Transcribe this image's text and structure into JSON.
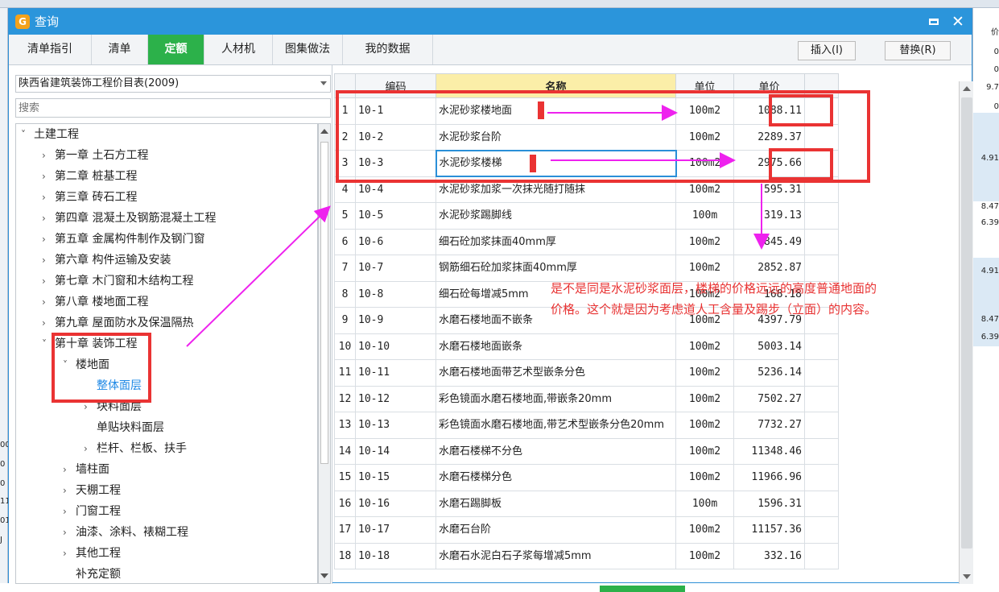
{
  "window": {
    "title": "查询"
  },
  "tabs": [
    {
      "label": "清单指引",
      "active": false
    },
    {
      "label": "清单",
      "active": false
    },
    {
      "label": "定额",
      "active": true
    },
    {
      "label": "人材机",
      "active": false
    },
    {
      "label": "图集做法",
      "active": false
    },
    {
      "label": "我的数据",
      "active": false
    }
  ],
  "actions": {
    "insert": "插入(I)",
    "replace": "替换(R)"
  },
  "left": {
    "library": "陕西省建筑装饰工程价目表(2009)",
    "search_placeholder": "搜索",
    "tree": [
      {
        "label": "土建工程",
        "chev": "˅"
      },
      {
        "label": "第一章 土石方工程",
        "chev": "›"
      },
      {
        "label": "第二章 桩基工程",
        "chev": "›"
      },
      {
        "label": "第三章 砖石工程",
        "chev": "›"
      },
      {
        "label": "第四章 混凝土及钢筋混凝土工程",
        "chev": "›"
      },
      {
        "label": "第五章 金属构件制作及钢门窗",
        "chev": "›"
      },
      {
        "label": "第六章 构件运输及安装",
        "chev": "›"
      },
      {
        "label": "第七章 木门窗和木结构工程",
        "chev": "›"
      },
      {
        "label": "第八章 楼地面工程",
        "chev": "›"
      },
      {
        "label": "第九章 屋面防水及保温隔热",
        "chev": "›"
      },
      {
        "label": "第十章 装饰工程",
        "chev": "˅"
      },
      {
        "label": "楼地面",
        "chev": "˅"
      },
      {
        "label": "整体面层",
        "chev": ""
      },
      {
        "label": "块料面层",
        "chev": "›"
      },
      {
        "label": "单贴块料面层",
        "chev": ""
      },
      {
        "label": "栏杆、栏板、扶手",
        "chev": "›"
      },
      {
        "label": "墙柱面",
        "chev": "›"
      },
      {
        "label": "天棚工程",
        "chev": "›"
      },
      {
        "label": "门窗工程",
        "chev": "›"
      },
      {
        "label": "油漆、涂料、裱糊工程",
        "chev": "›"
      },
      {
        "label": "其他工程",
        "chev": "›"
      },
      {
        "label": "补充定额",
        "chev": ""
      }
    ]
  },
  "grid": {
    "headers": {
      "code": "编码",
      "name": "名称",
      "unit": "单位",
      "price": "单价"
    },
    "rows": [
      {
        "no": "1",
        "code": "10-1",
        "name": "水泥砂浆楼地面",
        "unit": "100m2",
        "price": "1088.11"
      },
      {
        "no": "2",
        "code": "10-2",
        "name": "水泥砂浆台阶",
        "unit": "100m2",
        "price": "2289.37"
      },
      {
        "no": "3",
        "code": "10-3",
        "name": "水泥砂浆楼梯",
        "unit": "100m2",
        "price": "2975.66"
      },
      {
        "no": "4",
        "code": "10-4",
        "name": "水泥砂浆加浆一次抹光随打随抹",
        "unit": "100m2",
        "price": "595.31"
      },
      {
        "no": "5",
        "code": "10-5",
        "name": "水泥砂浆踢脚线",
        "unit": "100m",
        "price": "319.13"
      },
      {
        "no": "6",
        "code": "10-6",
        "name": "细石砼加浆抹面40mm厚",
        "unit": "100m2",
        "price": "1845.49"
      },
      {
        "no": "7",
        "code": "10-7",
        "name": "钢筋细石砼加浆抹面40mm厚",
        "unit": "100m2",
        "price": "2852.87"
      },
      {
        "no": "8",
        "code": "10-8",
        "name": "细石砼每增减5mm",
        "unit": "100m2",
        "price": "168.18"
      },
      {
        "no": "9",
        "code": "10-9",
        "name": "水磨石楼地面不嵌条",
        "unit": "100m2",
        "price": "4397.79"
      },
      {
        "no": "10",
        "code": "10-10",
        "name": "水磨石楼地面嵌条",
        "unit": "100m2",
        "price": "5003.14"
      },
      {
        "no": "11",
        "code": "10-11",
        "name": "水磨石楼地面带艺术型嵌条分色",
        "unit": "100m2",
        "price": "5236.14"
      },
      {
        "no": "12",
        "code": "10-12",
        "name": "彩色镜面水磨石楼地面,带嵌条20mm",
        "unit": "100m2",
        "price": "7502.27"
      },
      {
        "no": "13",
        "code": "10-13",
        "name": "彩色镜面水磨石楼地面,带艺术型嵌条分色20mm",
        "unit": "100m2",
        "price": "7732.27"
      },
      {
        "no": "14",
        "code": "10-14",
        "name": "水磨石楼梯不分色",
        "unit": "100m2",
        "price": "11348.46"
      },
      {
        "no": "15",
        "code": "10-15",
        "name": "水磨石楼梯分色",
        "unit": "100m2",
        "price": "11966.96"
      },
      {
        "no": "16",
        "code": "10-16",
        "name": "水磨石踢脚板",
        "unit": "100m",
        "price": "1596.31"
      },
      {
        "no": "17",
        "code": "10-17",
        "name": "水磨石台阶",
        "unit": "100m2",
        "price": "11157.36"
      },
      {
        "no": "18",
        "code": "10-18",
        "name": "水磨石水泥白石子浆每增减5mm",
        "unit": "100m2",
        "price": "332.16"
      }
    ]
  },
  "annotation": {
    "line1": "是不是同是水泥砂浆面层，楼梯的价格远远的高度普通地面的",
    "line2": "价格。这个就是因为考虑道人工含量及踢步（立面）的内容。",
    "color": "#ea3333",
    "arrow_color": "#ee22ee"
  },
  "background": {
    "right_values": [
      "0",
      "0",
      "9.7",
      "0",
      "4.91",
      "8.47",
      "6.39",
      "4.91",
      "8.47",
      "6.39"
    ],
    "right_header": "价",
    "left_values": [
      "00",
      "0",
      "0",
      "11",
      "01",
      "J"
    ]
  }
}
